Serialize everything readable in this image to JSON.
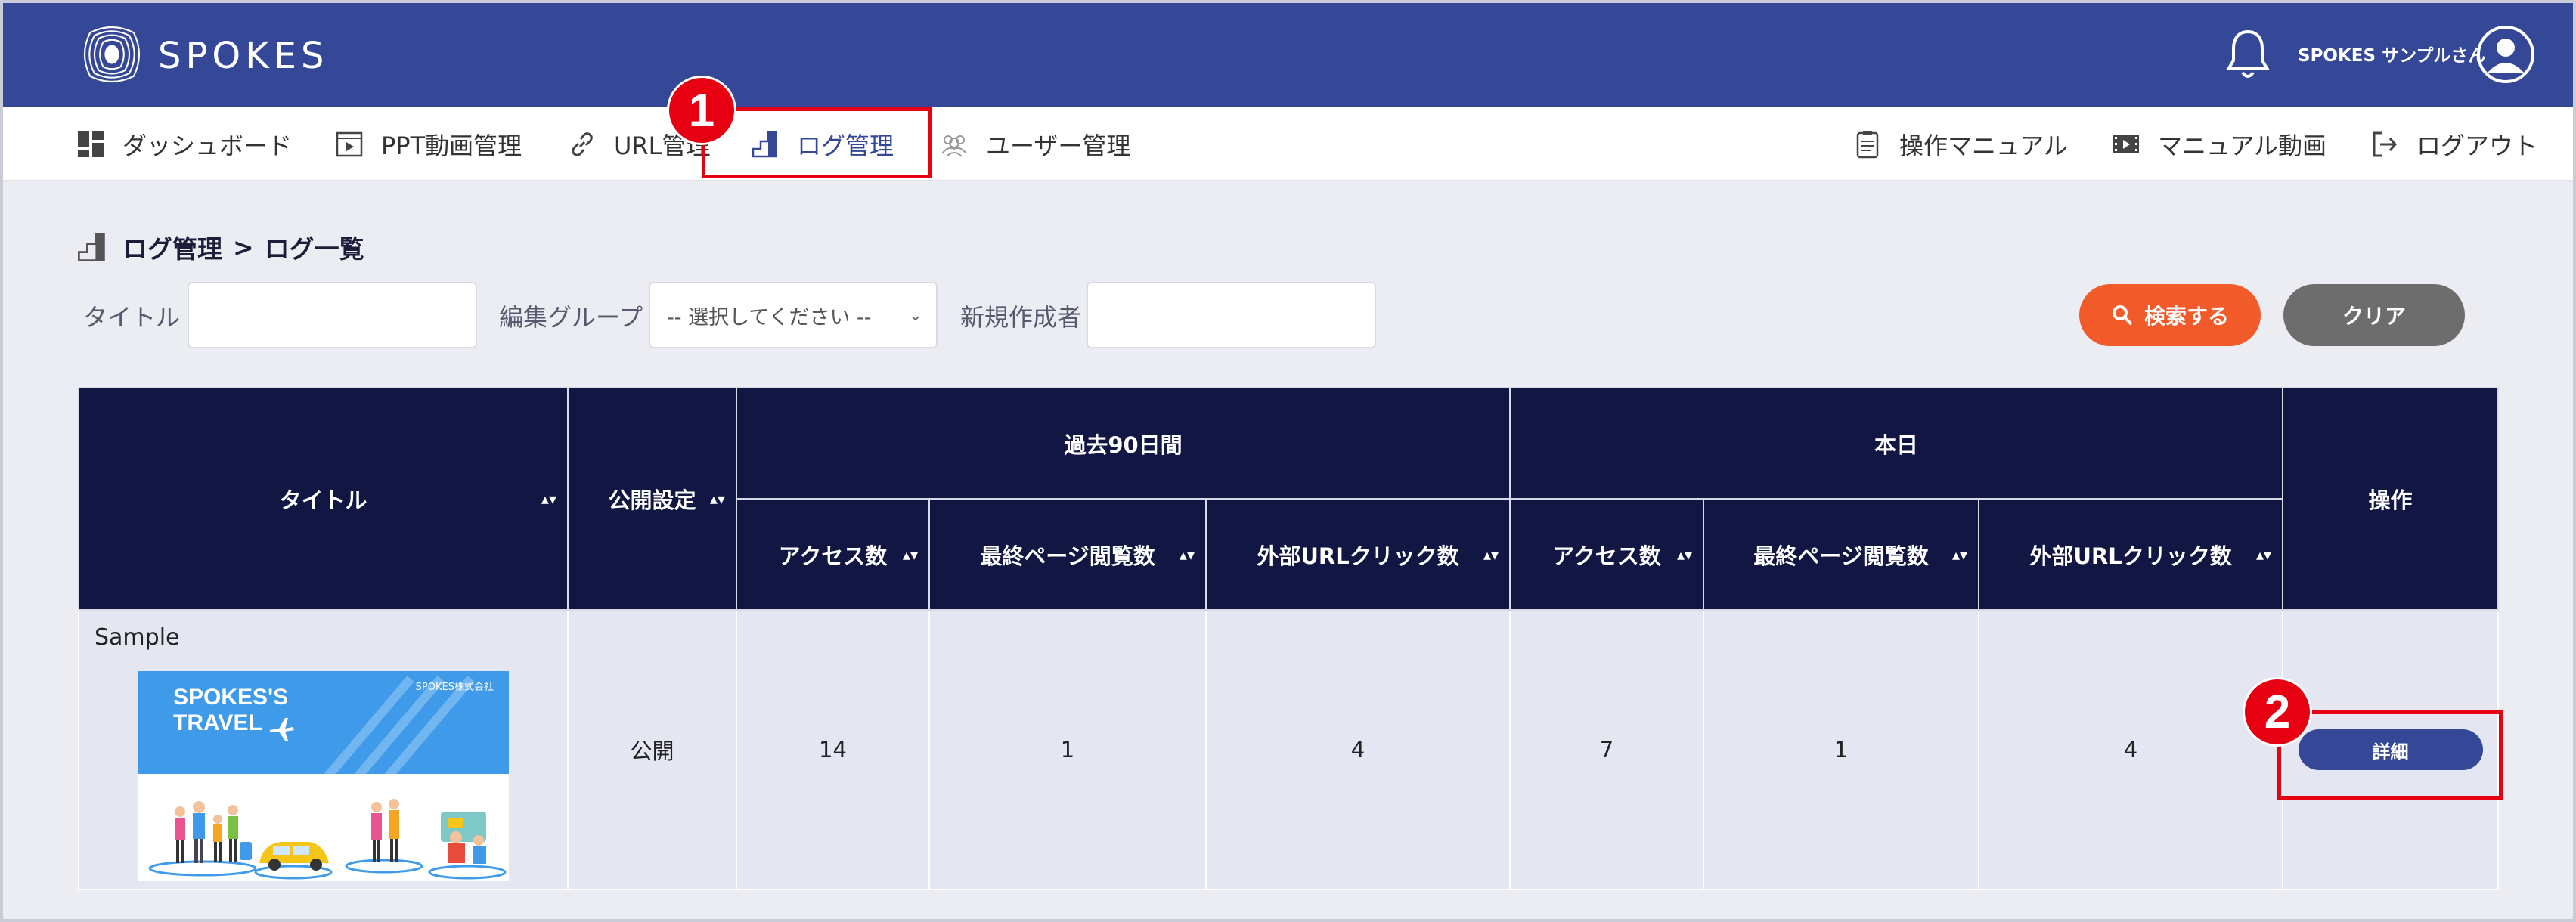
{
  "header": {
    "logo_text": "SPOKES",
    "user_name": "SPOKES サンプルさん"
  },
  "nav": {
    "left": [
      {
        "label": "ダッシュボード",
        "icon": "dashboard-icon"
      },
      {
        "label": "PPT動画管理",
        "icon": "ppt-video-icon"
      },
      {
        "label": "URL管理",
        "icon": "link-icon"
      },
      {
        "label": "ログ管理",
        "icon": "log-chart-icon",
        "active": true
      },
      {
        "label": "ユーザー管理",
        "icon": "users-icon"
      }
    ],
    "right": [
      {
        "label": "操作マニュアル",
        "icon": "manual-icon"
      },
      {
        "label": "マニュアル動画",
        "icon": "video-icon"
      },
      {
        "label": "ログアウト",
        "icon": "logout-icon"
      }
    ]
  },
  "breadcrumb": {
    "section": "ログ管理",
    "separator": ">",
    "page": "ログ一覧"
  },
  "filters": {
    "title_label": "タイトル",
    "title_value": "",
    "group_label": "編集グループ",
    "group_selected": "-- 選択してください --",
    "creator_label": "新規作成者",
    "creator_value": "",
    "search_button": "検索する",
    "clear_button": "クリア"
  },
  "table": {
    "headers": {
      "title": "タイトル",
      "publish": "公開設定",
      "past90": "過去90日間",
      "today": "本日",
      "actions": "操作",
      "access": "アクセス数",
      "last_page": "最終ページ閲覧数",
      "ext_url": "外部URLクリック数"
    },
    "rows": [
      {
        "title": "Sample",
        "thumbnail": {
          "title_line1": "SPOKES'S",
          "title_line2": "TRAVEL",
          "company": "SPOKES株式会社"
        },
        "publish": "公開",
        "past90_access": "14",
        "past90_last_page": "1",
        "past90_ext_url": "4",
        "today_access": "7",
        "today_last_page": "1",
        "today_ext_url": "4",
        "detail_button": "詳細"
      }
    ]
  },
  "annotations": {
    "badge1": "1",
    "badge2": "2",
    "highlight_color": "#e60012"
  },
  "colors": {
    "header_bg": "#354898",
    "table_header_bg": "#111642",
    "search_btn": "#f15a29",
    "clear_btn": "#6d6d6d"
  }
}
